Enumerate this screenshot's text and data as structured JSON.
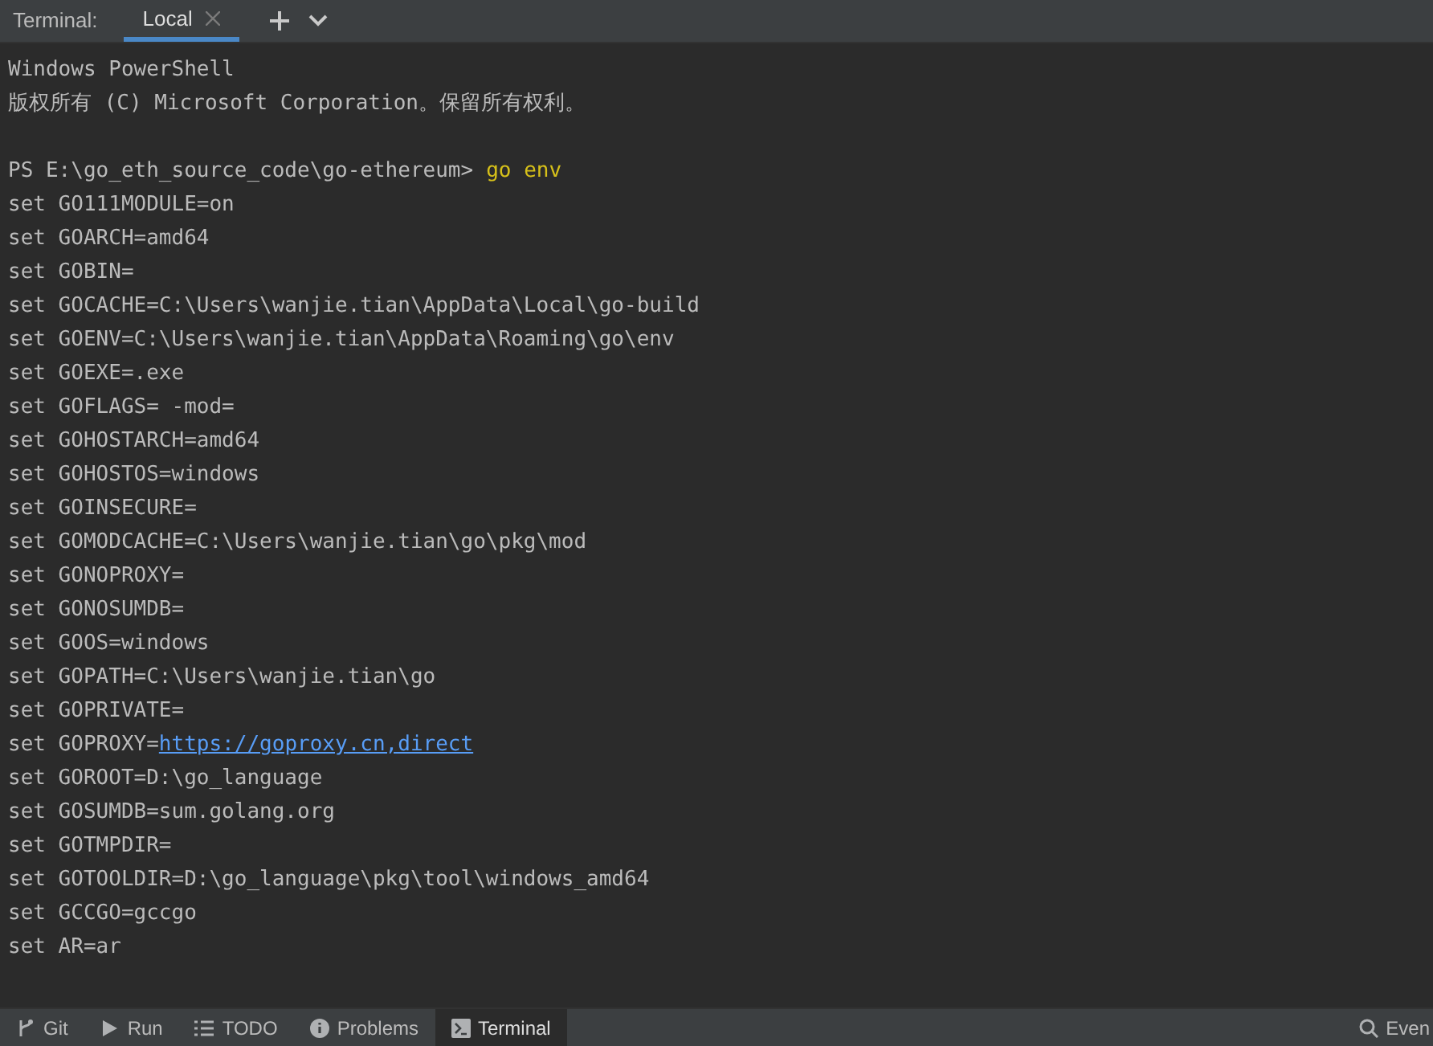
{
  "header": {
    "title": "Terminal:",
    "tabs": [
      {
        "label": "Local",
        "selected": true
      }
    ]
  },
  "lines": [
    {
      "kind": "text",
      "text": "Windows PowerShell"
    },
    {
      "kind": "text",
      "text": "版权所有 (C) Microsoft Corporation。保留所有权利。"
    },
    {
      "kind": "blank"
    },
    {
      "kind": "prompt",
      "prompt": "PS E:\\go_eth_source_code\\go-ethereum>",
      "command": "go env"
    },
    {
      "kind": "text",
      "text": "set GO111MODULE=on"
    },
    {
      "kind": "text",
      "text": "set GOARCH=amd64"
    },
    {
      "kind": "text",
      "text": "set GOBIN="
    },
    {
      "kind": "text",
      "text": "set GOCACHE=C:\\Users\\wanjie.tian\\AppData\\Local\\go-build"
    },
    {
      "kind": "text",
      "text": "set GOENV=C:\\Users\\wanjie.tian\\AppData\\Roaming\\go\\env"
    },
    {
      "kind": "text",
      "text": "set GOEXE=.exe"
    },
    {
      "kind": "text",
      "text": "set GOFLAGS= -mod="
    },
    {
      "kind": "text",
      "text": "set GOHOSTARCH=amd64"
    },
    {
      "kind": "text",
      "text": "set GOHOSTOS=windows"
    },
    {
      "kind": "text",
      "text": "set GOINSECURE="
    },
    {
      "kind": "text",
      "text": "set GOMODCACHE=C:\\Users\\wanjie.tian\\go\\pkg\\mod"
    },
    {
      "kind": "text",
      "text": "set GONOPROXY="
    },
    {
      "kind": "text",
      "text": "set GONOSUMDB="
    },
    {
      "kind": "text",
      "text": "set GOOS=windows"
    },
    {
      "kind": "text",
      "text": "set GOPATH=C:\\Users\\wanjie.tian\\go"
    },
    {
      "kind": "text",
      "text": "set GOPRIVATE="
    },
    {
      "kind": "link",
      "text": "set GOPROXY=",
      "link": "https://goproxy.cn,direct"
    },
    {
      "kind": "text",
      "text": "set GOROOT=D:\\go_language"
    },
    {
      "kind": "text",
      "text": "set GOSUMDB=sum.golang.org"
    },
    {
      "kind": "text",
      "text": "set GOTMPDIR="
    },
    {
      "kind": "text",
      "text": "set GOTOOLDIR=D:\\go_language\\pkg\\tool\\windows_amd64"
    },
    {
      "kind": "text",
      "text": "set GCCGO=gccgo"
    },
    {
      "kind": "text",
      "text": "set AR=ar"
    }
  ],
  "tool_windows": [
    {
      "label": "Git",
      "kind": "branch",
      "selected": false
    },
    {
      "label": "Run",
      "kind": "play",
      "selected": false
    },
    {
      "label": "TODO",
      "kind": "list",
      "selected": false
    },
    {
      "label": "Problems",
      "kind": "info",
      "selected": false
    },
    {
      "label": "Terminal",
      "kind": "terminal",
      "selected": true
    }
  ],
  "right_tool": {
    "label": "Even",
    "kind": "search"
  }
}
